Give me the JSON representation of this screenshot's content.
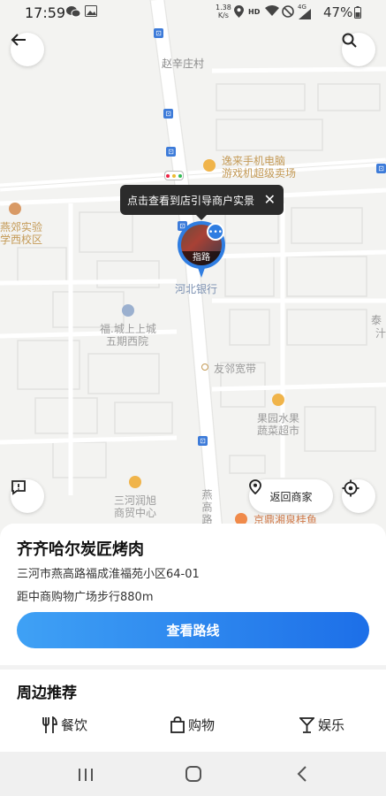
{
  "status_bar": {
    "time": "17:59",
    "net_speed_value": "1.38",
    "net_speed_unit": "K/s",
    "hd": "HD",
    "network": "4G",
    "battery": "47%"
  },
  "map": {
    "labels": {
      "zhao_xin_zhuang": "赵辛庄村",
      "yilai_line1": "逸来手机电脑",
      "yilai_line2": "游戏机超级卖场",
      "yanjiao_line1": "燕郊实验",
      "yanjiao_line2": "学西校区",
      "hebei_bank": "河北银行",
      "fuwei_line1": "福.城上上城",
      "fuwei_line2": "五期西院",
      "youlin": "友邻宽带",
      "guoyuan_line1": "果园水果",
      "guoyuan_line2": "蔬菜超市",
      "sanhe_line1": "三河润旭",
      "sanhe_line2": "商贸中心",
      "yangao_road": "燕高路",
      "jingding": "京鼎湘泉桂鱼",
      "tai": "泰",
      "mu": "汁"
    },
    "tooltip": "点击查看到店引导商户实景",
    "pin_label": "指路",
    "return_label": "返回商家"
  },
  "shop": {
    "name": "齐齐哈尔炭匠烤肉",
    "address": "三河市燕高路福成淮福苑小区64-01",
    "distance": "距中商购物广场步行880m",
    "route_button": "查看路线"
  },
  "nearby": {
    "title": "周边推荐",
    "categories": [
      "餐饮",
      "购物",
      "娱乐"
    ]
  },
  "colors": {
    "accent": "#1d6fe8",
    "pin": "#2f7de1",
    "poi_orange": "#f0b44a"
  }
}
